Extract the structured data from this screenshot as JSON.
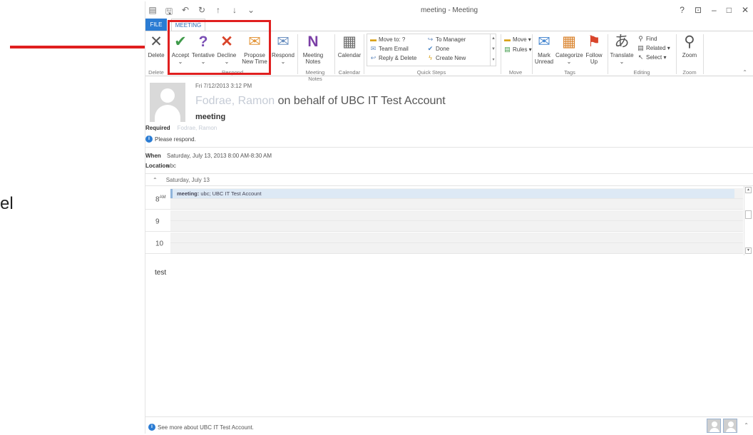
{
  "annotation": {
    "side_text": "el"
  },
  "window": {
    "title": "meeting - Meeting",
    "controls": [
      "?",
      "⊡",
      "–",
      "□",
      "✕"
    ]
  },
  "qat": [
    "▤",
    "🖫",
    "↶",
    "↻",
    "↑",
    "↓",
    "⌄"
  ],
  "tabs": {
    "file": "FILE",
    "meeting": "MEETING"
  },
  "ribbon": {
    "delete": {
      "label": "Delete",
      "group": "Delete"
    },
    "respond_group": {
      "label": "Respond",
      "accept": "Accept",
      "tentative": "Tentative",
      "decline": "Decline",
      "propose_1": "Propose",
      "propose_2": "New Time",
      "respond": "Respond"
    },
    "meeting_notes": {
      "line1": "Meeting",
      "line2": "Notes",
      "group": "Meeting Notes"
    },
    "calendar": {
      "label": "Calendar",
      "group": "Calendar"
    },
    "quick_steps": {
      "group": "Quick Steps",
      "items": [
        "Move to: ?",
        "Team Email",
        "Reply & Delete",
        "To Manager",
        "Done",
        "Create New"
      ]
    },
    "move": {
      "group": "Move",
      "move": "Move",
      "rules": "Rules"
    },
    "tags": {
      "group": "Tags",
      "mark_1": "Mark",
      "mark_2": "Unread",
      "categorize": "Categorize",
      "follow_1": "Follow",
      "follow_2": "Up"
    },
    "editing": {
      "group": "Editing",
      "translate": "Translate",
      "find": "Find",
      "related": "Related",
      "select": "Select"
    },
    "zoom": {
      "label": "Zoom",
      "group": "Zoom"
    }
  },
  "message": {
    "date": "Fri 7/12/2013 3:12 PM",
    "sender_blur": "Fodrae, Ramon",
    "from_suffix": "on behalf of UBC IT Test Account",
    "subject": "meeting",
    "required_label": "Required",
    "required_blur": "Fodrae, Ramon",
    "info": "Please respond.",
    "when_label": "When",
    "when_value": "Saturday, July 13, 2013 8:00 AM-8:30 AM",
    "location_label": "Location",
    "location_value": "ubc"
  },
  "calendar_preview": {
    "day": "Saturday, July 13",
    "hours": [
      {
        "h": "8",
        "ampm": "AM"
      },
      {
        "h": "9",
        "ampm": ""
      },
      {
        "h": "10",
        "ampm": ""
      }
    ],
    "event_title": "meeting:",
    "event_detail": "ubc; UBC IT Test Account"
  },
  "body": "test",
  "footer": "See more about UBC IT Test Account."
}
